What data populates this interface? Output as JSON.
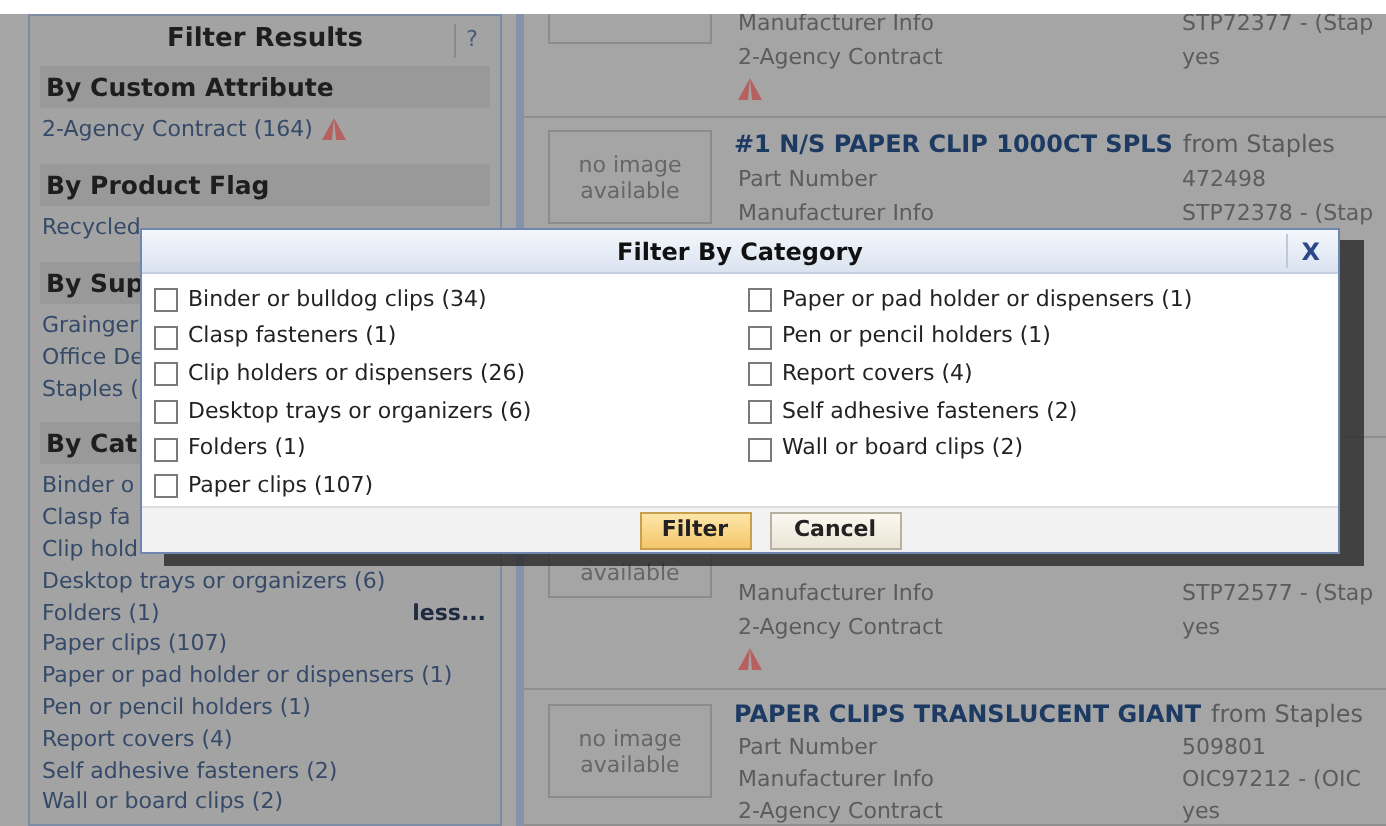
{
  "sidebar": {
    "title": "Filter Results",
    "help": "?",
    "sections": [
      {
        "heading": "By Custom Attribute",
        "items": [
          {
            "label": "2-Agency Contract (164)",
            "agency_mark": true
          }
        ]
      },
      {
        "heading": "By Product Flag",
        "items": [
          {
            "label": "Recycled"
          }
        ]
      },
      {
        "heading": "By Sup",
        "items": [
          {
            "label": "Grainger"
          },
          {
            "label": "Office De"
          },
          {
            "label": "Staples ("
          }
        ]
      },
      {
        "heading": "By Cat",
        "items": [
          {
            "label": "Binder o"
          },
          {
            "label": "Clasp fa"
          },
          {
            "label": "Clip hold"
          },
          {
            "label": "Desktop trays or organizers (6)"
          },
          {
            "label": "Folders (1)",
            "toggle": "less..."
          },
          {
            "label": "Paper clips (107)"
          },
          {
            "label": "Paper or pad holder or dispensers (1)"
          },
          {
            "label": "Pen or pencil holders (1)"
          },
          {
            "label": "Report covers (4)"
          },
          {
            "label": "Self adhesive fasteners (2)"
          },
          {
            "label": "Wall or board clips (2)"
          }
        ]
      }
    ]
  },
  "products": [
    {
      "fields": [
        {
          "label": "Manufacturer Info",
          "value": "STP72377 - (Stap"
        },
        {
          "label": "2-Agency Contract",
          "value": "yes"
        }
      ],
      "agency_mark": true
    },
    {
      "image_text": "no image available",
      "title": "#1 N/S PAPER CLIP 1000CT SPLS",
      "source": "from Staples",
      "fields": [
        {
          "label": "Part Number",
          "value": "472498"
        },
        {
          "label": "Manufacturer Info",
          "value": "STP72378 - (Stap"
        }
      ]
    },
    {
      "image_text": "available",
      "fields": [
        {
          "label": "Manufacturer Info",
          "value": "STP72577 - (Stap"
        },
        {
          "label": "2-Agency Contract",
          "value": "yes"
        }
      ],
      "agency_mark": true
    },
    {
      "image_text": "no image available",
      "title": "PAPER CLIPS TRANSLUCENT GIANT",
      "source": "from Staples",
      "fields": [
        {
          "label": "Part Number",
          "value": "509801"
        },
        {
          "label": "Manufacturer Info",
          "value": "OIC97212 - (OIC"
        },
        {
          "label": "2-Agency Contract",
          "value": "yes"
        }
      ]
    }
  ],
  "dialog": {
    "title": "Filter By Category",
    "close": "X",
    "options": [
      {
        "label": "Binder or bulldog clips (34)",
        "checked": false
      },
      {
        "label": "Clasp fasteners (1)",
        "checked": false
      },
      {
        "label": "Clip holders or dispensers (26)",
        "checked": false
      },
      {
        "label": "Desktop trays or organizers (6)",
        "checked": false
      },
      {
        "label": "Folders (1)",
        "checked": false
      },
      {
        "label": "Paper clips (107)",
        "checked": false
      },
      {
        "label": "Paper or pad holder or dispensers (1)",
        "checked": false
      },
      {
        "label": "Pen or pencil holders (1)",
        "checked": false
      },
      {
        "label": "Report covers (4)",
        "checked": false
      },
      {
        "label": "Self adhesive fasteners (2)",
        "checked": false
      },
      {
        "label": "Wall or board clips (2)",
        "checked": false
      }
    ],
    "buttons": [
      {
        "label": "Filter",
        "kind": "primary"
      },
      {
        "label": "Cancel",
        "kind": "secondary"
      }
    ]
  }
}
